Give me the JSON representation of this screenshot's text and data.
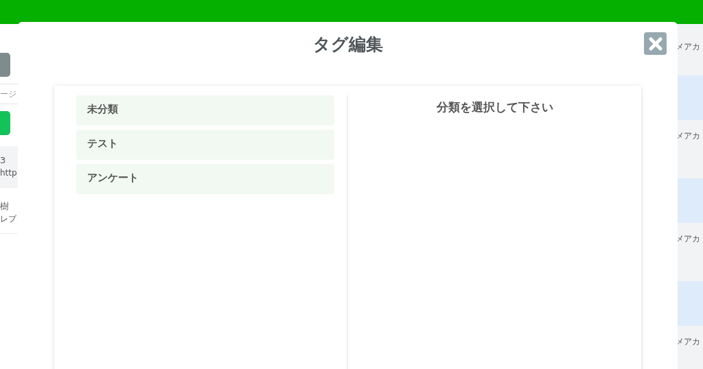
{
  "background": {
    "left": [
      {
        "kind": "button",
        "color": "#7f8c8d"
      },
      {
        "kind": "field",
        "text": "ージ"
      },
      {
        "kind": "button",
        "color": "#14c25a"
      },
      {
        "kind": "row",
        "lines": [
          "3",
          "http"
        ],
        "shaded": true
      },
      {
        "kind": "row",
        "lines": [
          "樹",
          "レプ"
        ],
        "shaded": false
      }
    ],
    "right": [
      {
        "text": "メアカ",
        "shaded": false
      },
      {
        "text": "メアカ",
        "shaded": true
      },
      {
        "text": "メアカ",
        "shaded": true
      },
      {
        "text": "メアカ",
        "shaded": true
      }
    ]
  },
  "modal": {
    "title": "タグ編集",
    "categories": [
      {
        "label": "未分類",
        "selected": false
      },
      {
        "label": "テスト",
        "selected": false
      },
      {
        "label": "アンケート",
        "selected": false
      }
    ],
    "prompt": "分類を選択して下さい"
  }
}
